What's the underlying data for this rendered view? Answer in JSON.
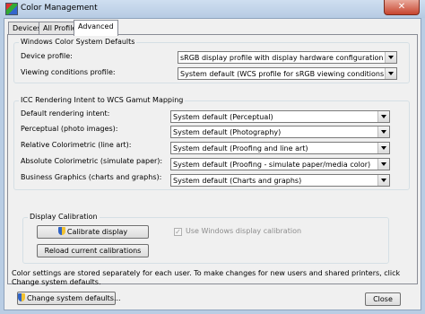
{
  "window": {
    "title": "Color Management",
    "close_glyph": "✕"
  },
  "tabs": [
    {
      "label": "Devices"
    },
    {
      "label": "All Profiles"
    },
    {
      "label": "Advanced",
      "active": true
    }
  ],
  "wcs_defaults": {
    "title": "Windows Color System Defaults",
    "device_profile": {
      "label": "Device profile:",
      "value": "sRGB display profile with display hardware configuration data derived f"
    },
    "viewing_conditions": {
      "label": "Viewing conditions profile:",
      "value": "System default (WCS profile for sRGB viewing conditions)"
    }
  },
  "icc_mapping": {
    "title": "ICC Rendering Intent to WCS Gamut Mapping",
    "rows": [
      {
        "label": "Default rendering intent:",
        "value": "System default (Perceptual)"
      },
      {
        "label": "Perceptual (photo images):",
        "value": "System default (Photography)"
      },
      {
        "label": "Relative Colorimetric (line art):",
        "value": "System default (Proofing and line art)"
      },
      {
        "label": "Absolute Colorimetric (simulate paper):",
        "value": "System default (Proofing - simulate paper/media color)"
      },
      {
        "label": "Business Graphics (charts and graphs):",
        "value": "System default (Charts and graphs)"
      }
    ]
  },
  "calibration": {
    "title": "Display Calibration",
    "calibrate_button": "Calibrate display",
    "reload_button": "Reload current calibrations",
    "checkbox_label": "Use Windows display calibration",
    "checkbox_checked": true,
    "checkbox_glyph": "✓"
  },
  "footer": {
    "note": "Color settings are stored separately for each user. To make changes for new users and shared printers, click Change system defaults.",
    "change_defaults_button": "Change system defaults...",
    "close_button": "Close"
  },
  "colors": {
    "title_bar": "#b9cde4",
    "close_red": "#c7442e",
    "panel_bg": "#f0f0f0"
  }
}
